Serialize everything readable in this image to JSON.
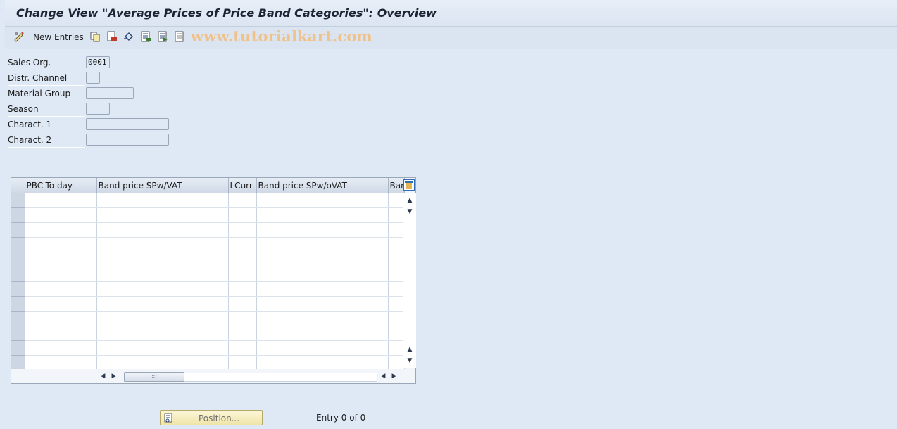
{
  "window": {
    "title": "Change View \"Average Prices of Price Band Categories\": Overview"
  },
  "toolbar": {
    "new_entries_label": "New Entries",
    "icons": [
      "display-change-icon",
      "copy-icon",
      "delete-icon",
      "undo-icon",
      "select-all-icon",
      "select-block-icon",
      "deselect-all-icon"
    ],
    "watermark": "www.tutorialkart.com",
    "watermark_color": "#f0c188"
  },
  "fields": [
    {
      "label": "Sales Org.",
      "value": "0001"
    },
    {
      "label": "Distr. Channel",
      "value": ""
    },
    {
      "label": "Material Group",
      "value": ""
    },
    {
      "label": "Season",
      "value": ""
    },
    {
      "label": "Charact. 1",
      "value": ""
    },
    {
      "label": "Charact. 2",
      "value": ""
    }
  ],
  "table": {
    "columns": [
      "PBC",
      "To day",
      "Band price SPw/VAT",
      "LCurr",
      "Band price SPw/oVAT",
      "Bar"
    ],
    "row_count": 12
  },
  "footer": {
    "position_label": "Position...",
    "entry_info": "Entry 0 of 0"
  },
  "colors": {
    "background": "#dfe9f5",
    "header_bg": "#cfd9e6",
    "position_button": "#efe4a8"
  }
}
